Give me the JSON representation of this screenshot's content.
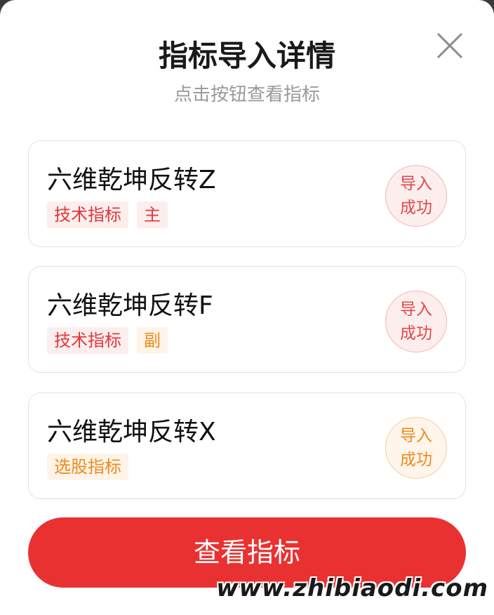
{
  "dialog": {
    "title": "指标导入详情",
    "subtitle": "点击按钮查看指标",
    "close_icon": "close-icon"
  },
  "indicators": [
    {
      "name": "六维乾坤反转Z",
      "tags": [
        {
          "label": "技术指标",
          "color": "#e03a3a"
        },
        {
          "label": "主",
          "color": "#e03a3a"
        }
      ],
      "status": {
        "line1": "导入",
        "line2": "成功",
        "color": "#e04848"
      }
    },
    {
      "name": "六维乾坤反转F",
      "tags": [
        {
          "label": "技术指标",
          "color": "#e03a3a"
        },
        {
          "label": "副",
          "color": "#ee8a1c"
        }
      ],
      "status": {
        "line1": "导入",
        "line2": "成功",
        "color": "#e04848"
      }
    },
    {
      "name": "六维乾坤反转X",
      "tags": [
        {
          "label": "选股指标",
          "color": "#ee8a1c"
        }
      ],
      "status": {
        "line1": "导入",
        "line2": "成功",
        "color": "#ee8a1c"
      }
    }
  ],
  "primary_button": {
    "label": "查看指标",
    "color": "#ea3131"
  },
  "watermark": "www.zhibiaodi.com"
}
